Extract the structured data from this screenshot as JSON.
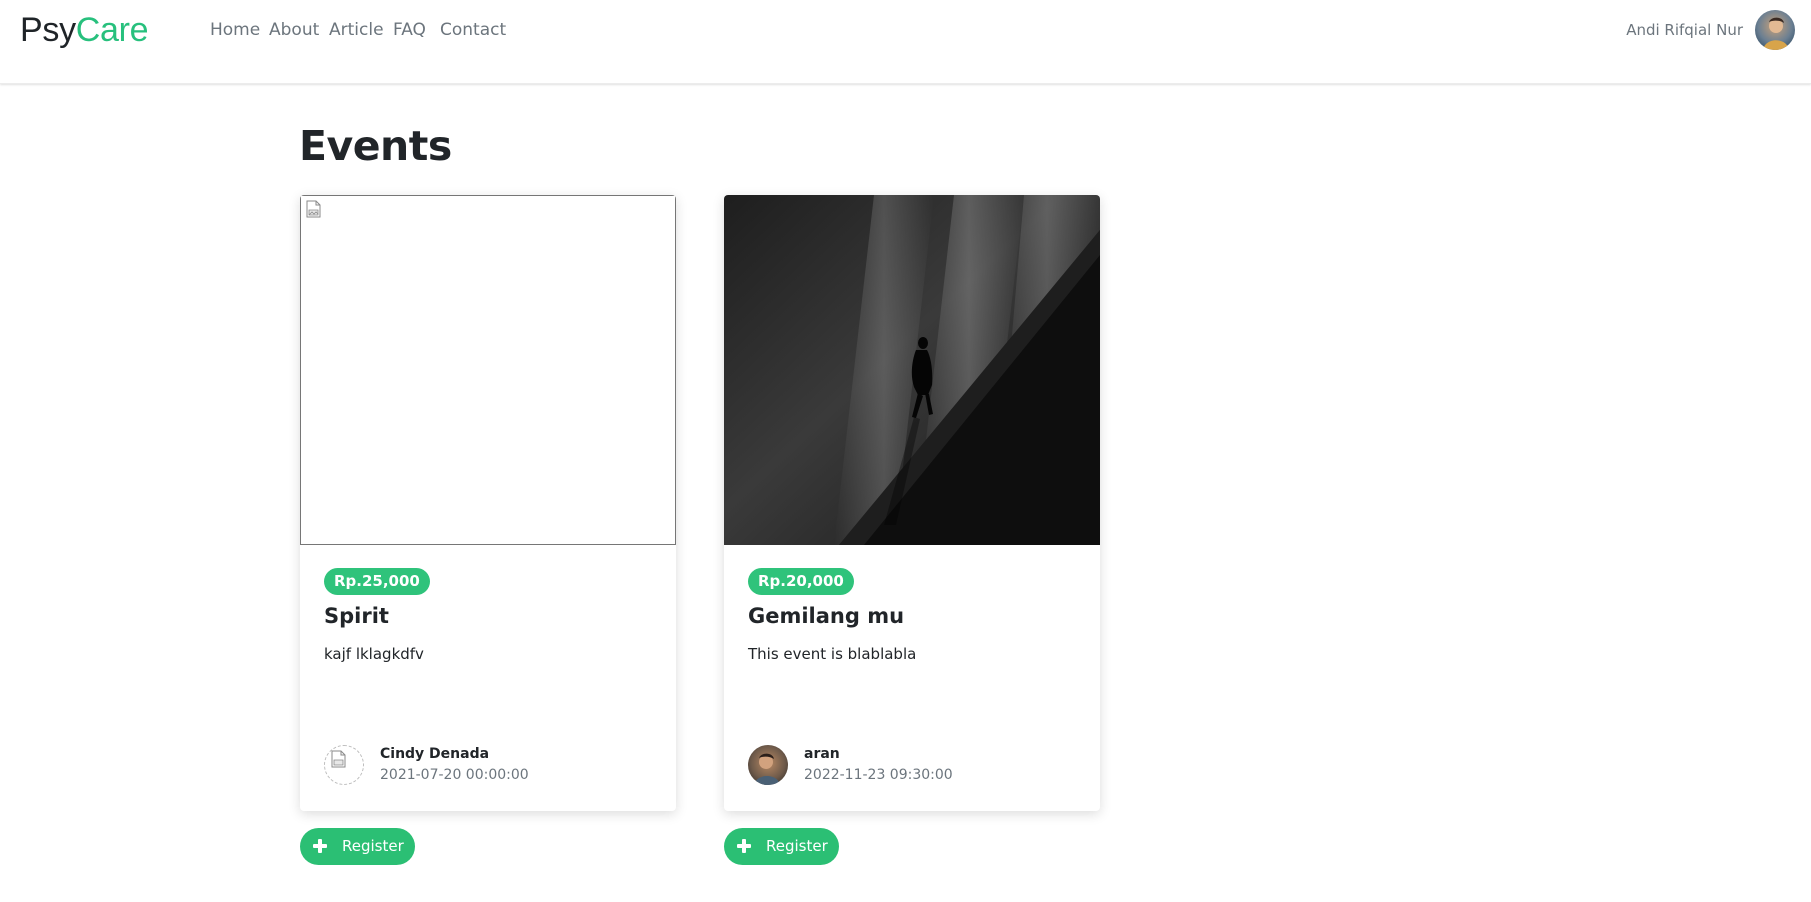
{
  "brand": {
    "part1": "Psy",
    "part2": "Care",
    "accent_color": "#27c07d"
  },
  "nav": {
    "links": [
      {
        "label": "Home"
      },
      {
        "label": "About"
      },
      {
        "label": "Article"
      },
      {
        "label": "FAQ"
      },
      {
        "label": "Contact"
      }
    ]
  },
  "user": {
    "name": "Andi Rifqial Nur",
    "avatar_icon": "user-avatar-photo"
  },
  "page": {
    "heading": "Events"
  },
  "events": [
    {
      "price": "Rp.25,000",
      "title": "Spirit",
      "description": "kajf lklagkdfv",
      "author": "Cindy Denada",
      "date": "2021-07-20 00:00:00",
      "image_icon": "broken-image-icon",
      "register_label": "Register"
    },
    {
      "price": "Rp.20,000",
      "title": "Gemilang mu",
      "description": "This event is blablabla",
      "author": "aran",
      "date": "2022-11-23 09:30:00",
      "image_icon": "silhouette-photo",
      "register_label": "Register"
    }
  ],
  "colors": {
    "badge": "#2fc37b",
    "button": "#2bbf74",
    "muted": "#6c757d",
    "text": "#212529"
  }
}
